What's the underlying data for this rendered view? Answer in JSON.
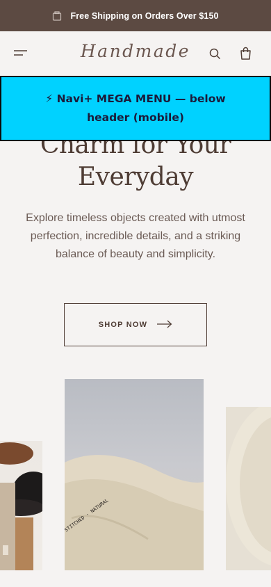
{
  "announcement": {
    "text": "Free Shipping on Orders Over $150",
    "icon": "gift-icon"
  },
  "header": {
    "logo": "Handmade",
    "menu_icon": "menu-icon",
    "search_icon": "search-icon",
    "bag_icon": "shopping-bag-icon"
  },
  "mega_menu": {
    "text": "⚡ Navi+ MEGA MENU — below header (mobile)"
  },
  "hero": {
    "title_line1": "Charm for Your",
    "title_line2": "Everyday",
    "description": "Explore timeless objects created with utmost perfection, incredible details, and a striking balance of beauty and simplicity.",
    "cta": "SHOP NOW"
  },
  "colors": {
    "announcement_bg": "#5c4a42",
    "page_bg": "#f5f3f2",
    "mega_menu_bg": "#00d2ff",
    "text_dark": "#4e3c34"
  }
}
